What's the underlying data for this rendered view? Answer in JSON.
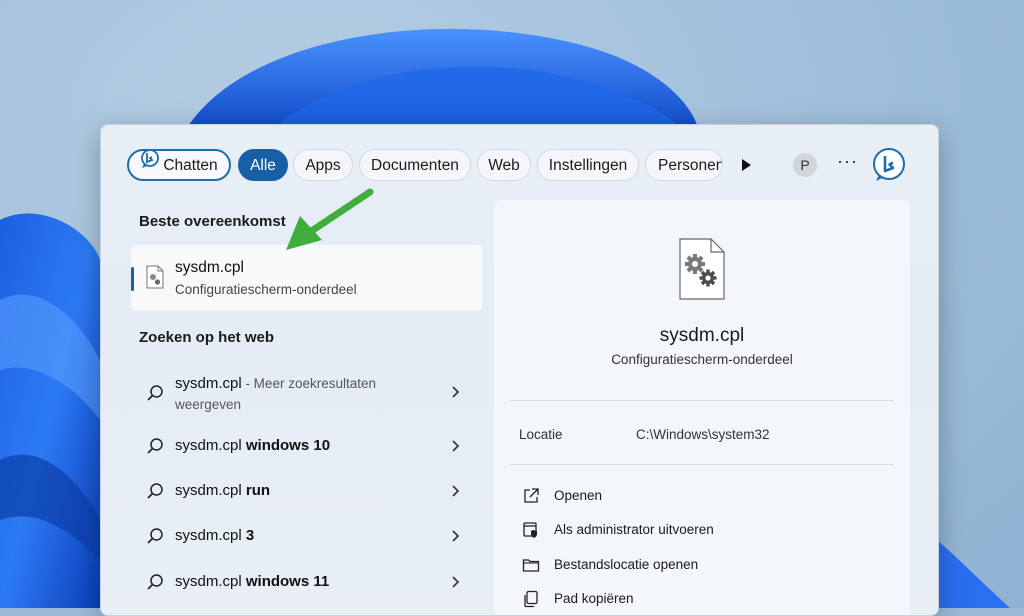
{
  "filters": {
    "chat": "Chatten",
    "all": "Alle",
    "apps": "Apps",
    "documents": "Documenten",
    "web": "Web",
    "settings": "Instellingen",
    "people": "Personen",
    "avatar_initial": "P",
    "more": "···"
  },
  "left": {
    "best_match_title": "Beste overeenkomst",
    "best_match": {
      "name": "sysdm.cpl",
      "type": "Configuratiescherm-onderdeel"
    },
    "web_title": "Zoeken op het web",
    "web_results": [
      {
        "query": "sysdm.cpl",
        "suffix": " - Meer zoekresultaten",
        "line2": "weergeven"
      },
      {
        "query": "sysdm.cpl ",
        "bold": "windows 10"
      },
      {
        "query": "sysdm.cpl ",
        "bold": "run"
      },
      {
        "query": "sysdm.cpl ",
        "bold": "3"
      },
      {
        "query": "sysdm.cpl ",
        "bold": "windows 11"
      }
    ]
  },
  "preview": {
    "title": "sysdm.cpl",
    "subtitle": "Configuratiescherm-onderdeel",
    "location_label": "Locatie",
    "location_value": "C:\\Windows\\system32",
    "actions": [
      {
        "label": "Openen",
        "icon": "open-external-icon"
      },
      {
        "label": "Als administrator uitvoeren",
        "icon": "admin-shield-icon"
      },
      {
        "label": "Bestandslocatie openen",
        "icon": "folder-icon"
      },
      {
        "label": "Pad kopiëren",
        "icon": "copy-icon"
      }
    ]
  },
  "colors": {
    "accent": "#185fa8",
    "arrow": "#3fae3a"
  }
}
